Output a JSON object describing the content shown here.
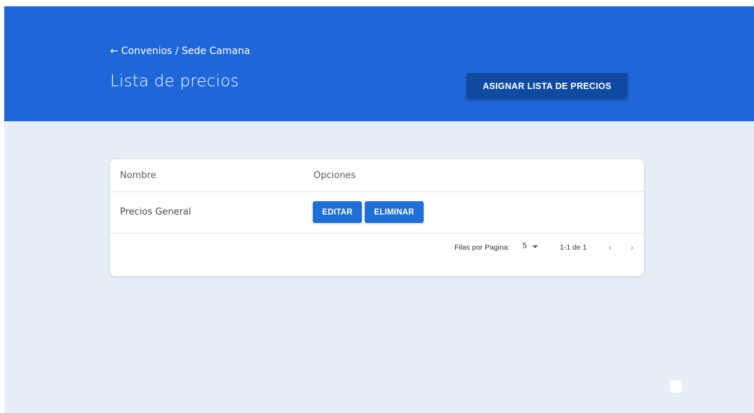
{
  "header": {
    "breadcrumb": {
      "arrow": "←",
      "text": "Convenios / Sede Camana"
    },
    "title": "Lista de precios",
    "assign_button_label": "ASIGNAR LISTA DE PRECIOS"
  },
  "table": {
    "columns": [
      "Nombre",
      "Opciones"
    ],
    "rows": [
      {
        "name": "Precios General",
        "actions": [
          "EDITAR",
          "ELIMINAR"
        ]
      }
    ],
    "footer": {
      "rows_per_page_label": "Filas por Pagina:",
      "rows_per_page_value": "5",
      "range_label": "1-1 de 1",
      "prev_icon": "‹",
      "next_icon": "›"
    }
  },
  "colors": {
    "header_bg": "#1f67d9",
    "page_bg": "#e6eff7",
    "primary_button": "#0f4aa0",
    "action_button": "#1f6fd6"
  }
}
